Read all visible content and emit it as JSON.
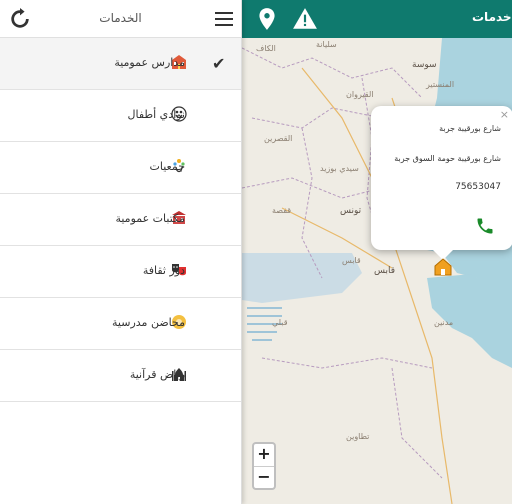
{
  "sidebar": {
    "title": "الخدمات",
    "items": [
      {
        "label": "مدارس عمومية",
        "icon": "school-icon",
        "active": true
      },
      {
        "label": "نوادي أطفال",
        "icon": "children-club-icon"
      },
      {
        "label": "جمعيات",
        "icon": "associations-icon"
      },
      {
        "label": "مكتبات عمومية",
        "icon": "library-icon"
      },
      {
        "label": "دور ثقافة",
        "icon": "theater-masks-icon"
      },
      {
        "label": "محاضن مدرسية",
        "icon": "nursery-icon"
      },
      {
        "label": "رياض قرآنية",
        "icon": "mosque-icon"
      }
    ]
  },
  "topbar": {
    "title": "خدمات"
  },
  "map": {
    "labels": [
      "الكاف",
      "سليانة",
      "سوسة",
      "المنستير",
      "القيروان",
      "القصرين",
      "سيدي بوزيد",
      "قفصة",
      "تونس",
      "قابس",
      "قابس",
      "قبلي",
      "مدنين",
      "تطاوين"
    ],
    "zoom_in": "+",
    "zoom_out": "−"
  },
  "popup": {
    "close": "×",
    "line1": "شارع بورقيبة جربة",
    "line2": "شارع بورقيبة حومة السوق جربة",
    "phone": "75653047"
  },
  "colors": {
    "topbar": "#0f7a6e",
    "marker": "#f0a020",
    "call": "#1a8a2a"
  }
}
